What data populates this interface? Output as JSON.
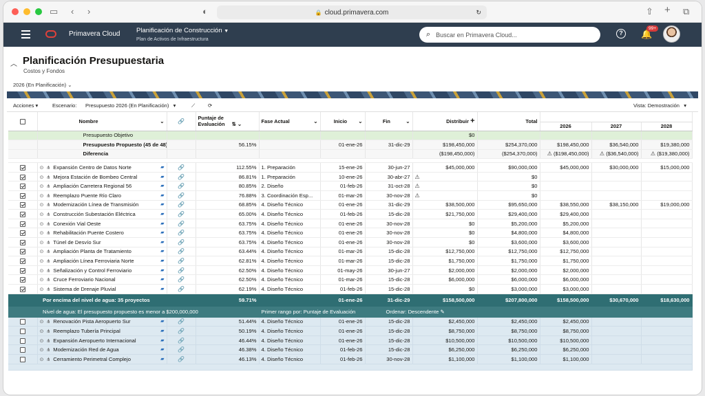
{
  "browser": {
    "url": "cloud.primavera.com",
    "dot_colors": [
      "#fe5f57",
      "#febc2e",
      "#28c840"
    ]
  },
  "header": {
    "app_name": "Primavera Cloud",
    "project": "Planificación de Construcción",
    "project_sub": "Plan de Activos de Infraestructura",
    "search_placeholder": "Buscar en Primavera Cloud...",
    "notification_count": "99+"
  },
  "page": {
    "title": "Planificación Presupuestaria",
    "subtitle": "Costos y Fondos",
    "year_selector": "2026 (En Planificación)"
  },
  "toolbar": {
    "actions": "Acciones",
    "scenario_label": "Escenario:",
    "scenario_value": "Presupuesto 2026 (En Planificación)",
    "view": "Vista: Demostración"
  },
  "columns": {
    "name": "Nombre",
    "score_1": "Puntaje de",
    "score_2": "Evaluación",
    "phase": "Fase Actual",
    "start": "Inicio",
    "end": "Fin",
    "distrib": "Distribuir",
    "total": "Total",
    "y1": "2026",
    "y2": "2027",
    "y3": "2028"
  },
  "summary": {
    "objective": {
      "name": "Presupuesto Objetivo",
      "distrib": "$0"
    },
    "proposed": {
      "name": "Presupuesto Propuesto (45 de 48)",
      "score": "56.15%",
      "start": "01-ene-26",
      "end": "31-dic-29",
      "distrib": "$198,450,000",
      "total": "$254,370,000",
      "y1": "$198,450,000",
      "y2": "$36,540,000",
      "y3": "$19,380,000"
    },
    "difference": {
      "name": "Diferencia",
      "distrib": "($198,450,000)",
      "total": "($254,370,000)",
      "y1": "($198,450,000)",
      "y2": "($36,540,000)",
      "y3": "($19,380,000)"
    }
  },
  "rows": [
    {
      "name": "Expansión Centro de Datos Norte",
      "score": "112.55%",
      "phase": "1. Preparación",
      "start": "15-ene-26",
      "end": "30-jun-27",
      "distrib": "$45,000,000",
      "total": "$90,000,000",
      "y1": "$45,000,000",
      "y2": "$30,000,000",
      "y3": "$15,000,000"
    },
    {
      "name": "Mejora Estación de Bombeo Central",
      "score": "86.81%",
      "phase": "1. Preparación",
      "start": "10-ene-26",
      "end": "30-abr-27",
      "distrib": "⚠",
      "total": "$0",
      "y1": "",
      "y2": "",
      "y3": ""
    },
    {
      "name": "Ampliación Carretera Regional 56",
      "score": "80.85%",
      "phase": "2. Diseño",
      "start": "01-feb-26",
      "end": "31-oct-28",
      "distrib": "⚠",
      "total": "$0",
      "y1": "",
      "y2": "",
      "y3": ""
    },
    {
      "name": "Reemplazo Puente Río Claro",
      "score": "76.88%",
      "phase": "3. Coordinación Esp...",
      "start": "01-mar-26",
      "end": "30-nov-28",
      "distrib": "⚠",
      "total": "$0",
      "y1": "",
      "y2": "",
      "y3": ""
    },
    {
      "name": "Modernización Línea de Transmisión",
      "score": "68.85%",
      "phase": "4. Diseño Técnico",
      "start": "01-ene-26",
      "end": "31-dic-29",
      "distrib": "$38,500,000",
      "total": "$95,650,000",
      "y1": "$38,550,000",
      "y2": "$38,150,000",
      "y3": "$19,000,000"
    },
    {
      "name": "Construcción Subestación Eléctrica",
      "score": "65.00%",
      "phase": "4. Diseño Técnico",
      "start": "01-feb-26",
      "end": "15-dic-28",
      "distrib": "$21,750,000",
      "total": "$29,400,000",
      "y1": "$29,400,000",
      "y2": "",
      "y3": ""
    },
    {
      "name": "Conexión Vial Oeste",
      "score": "63.75%",
      "phase": "4. Diseño Técnico",
      "start": "01-ene-26",
      "end": "30-nov-28",
      "distrib": "$0",
      "total": "$5,200,000",
      "y1": "$5,200,000",
      "y2": "",
      "y3": ""
    },
    {
      "name": "Rehabilitación Puente Costero",
      "score": "63.75%",
      "phase": "4. Diseño Técnico",
      "start": "01-ene-26",
      "end": "30-nov-28",
      "distrib": "$0",
      "total": "$4,800,000",
      "y1": "$4,800,000",
      "y2": "",
      "y3": ""
    },
    {
      "name": "Túnel de Desvío Sur",
      "score": "63.75%",
      "phase": "4. Diseño Técnico",
      "start": "01-ene-26",
      "end": "30-nov-28",
      "distrib": "$0",
      "total": "$3,600,000",
      "y1": "$3,600,000",
      "y2": "",
      "y3": ""
    },
    {
      "name": "Ampliación Planta de Tratamiento",
      "score": "63.44%",
      "phase": "4. Diseño Técnico",
      "start": "01-mar-26",
      "end": "15-dic-28",
      "distrib": "$12,750,000",
      "total": "$12,750,000",
      "y1": "$12,750,000",
      "y2": "",
      "y3": ""
    },
    {
      "name": "Ampliación Línea Ferroviaria Norte",
      "score": "62.81%",
      "phase": "4. Diseño Técnico",
      "start": "01-mar-26",
      "end": "15-dic-28",
      "distrib": "$1,750,000",
      "total": "$1,750,000",
      "y1": "$1,750,000",
      "y2": "",
      "y3": ""
    },
    {
      "name": "Señalización y Control Ferroviario",
      "score": "62.50%",
      "phase": "4. Diseño Técnico",
      "start": "01-may-26",
      "end": "30-jun-27",
      "distrib": "$2,000,000",
      "total": "$2,000,000",
      "y1": "$2,000,000",
      "y2": "",
      "y3": ""
    },
    {
      "name": "Cruce Ferroviario Nacional",
      "score": "62.50%",
      "phase": "4. Diseño Técnico",
      "start": "01-mar-26",
      "end": "15-dic-28",
      "distrib": "$6,000,000",
      "total": "$6,000,000",
      "y1": "$6,000,000",
      "y2": "",
      "y3": ""
    },
    {
      "name": "Sistema de Drenaje Pluvial",
      "score": "62.19%",
      "phase": "4. Diseño Técnico",
      "start": "01-feb-26",
      "end": "15-dic-28",
      "distrib": "$0",
      "total": "$3,000,000",
      "y1": "$3,000,000",
      "y2": "",
      "y3": ""
    }
  ],
  "waterline": {
    "label": "Por encima del nivel de agua: 35 proyectos",
    "score": "59.71%",
    "start": "01-ene-26",
    "end": "31-dic-29",
    "distrib": "$158,500,000",
    "total": "$207,800,000",
    "y1": "$158,500,000",
    "y2": "$30,670,000",
    "y3": "$18,630,000",
    "note": "Nivel de agua: El presupuesto propuesto es menor a $200,000,000",
    "rank": "Primer rango por: Puntaje de Evaluación",
    "order": "Ordenar: Descendente"
  },
  "below_rows": [
    {
      "name": "Renovación Pista Aeropuerto Sur",
      "score": "51.44%",
      "phase": "4. Diseño Técnico",
      "start": "01-ene-26",
      "end": "15-dic-28",
      "distrib": "$2,450,000",
      "total": "$2,450,000",
      "y1": "$2,450,000"
    },
    {
      "name": "Reemplazo Tubería Principal",
      "score": "50.19%",
      "phase": "4. Diseño Técnico",
      "start": "01-ene-26",
      "end": "15-dic-28",
      "distrib": "$8,750,000",
      "total": "$8,750,000",
      "y1": "$8,750,000"
    },
    {
      "name": "Expansión Aeropuerto Internacional",
      "score": "46.44%",
      "phase": "4. Diseño Técnico",
      "start": "01-ene-26",
      "end": "15-dic-28",
      "distrib": "$10,500,000",
      "total": "$10,500,000",
      "y1": "$10,500,000"
    },
    {
      "name": "Modernización Red de Agua",
      "score": "46.38%",
      "phase": "4. Diseño Técnico",
      "start": "01-feb-26",
      "end": "15-dic-28",
      "distrib": "$6,250,000",
      "total": "$6,250,000",
      "y1": "$6,250,000"
    },
    {
      "name": "Cerramiento Perimetral Complejo",
      "score": "46.13%",
      "phase": "4. Diseño Técnico",
      "start": "01-feb-26",
      "end": "30-nov-28",
      "distrib": "$1,100,000",
      "total": "$1,100,000",
      "y1": "$1,100,000"
    }
  ]
}
